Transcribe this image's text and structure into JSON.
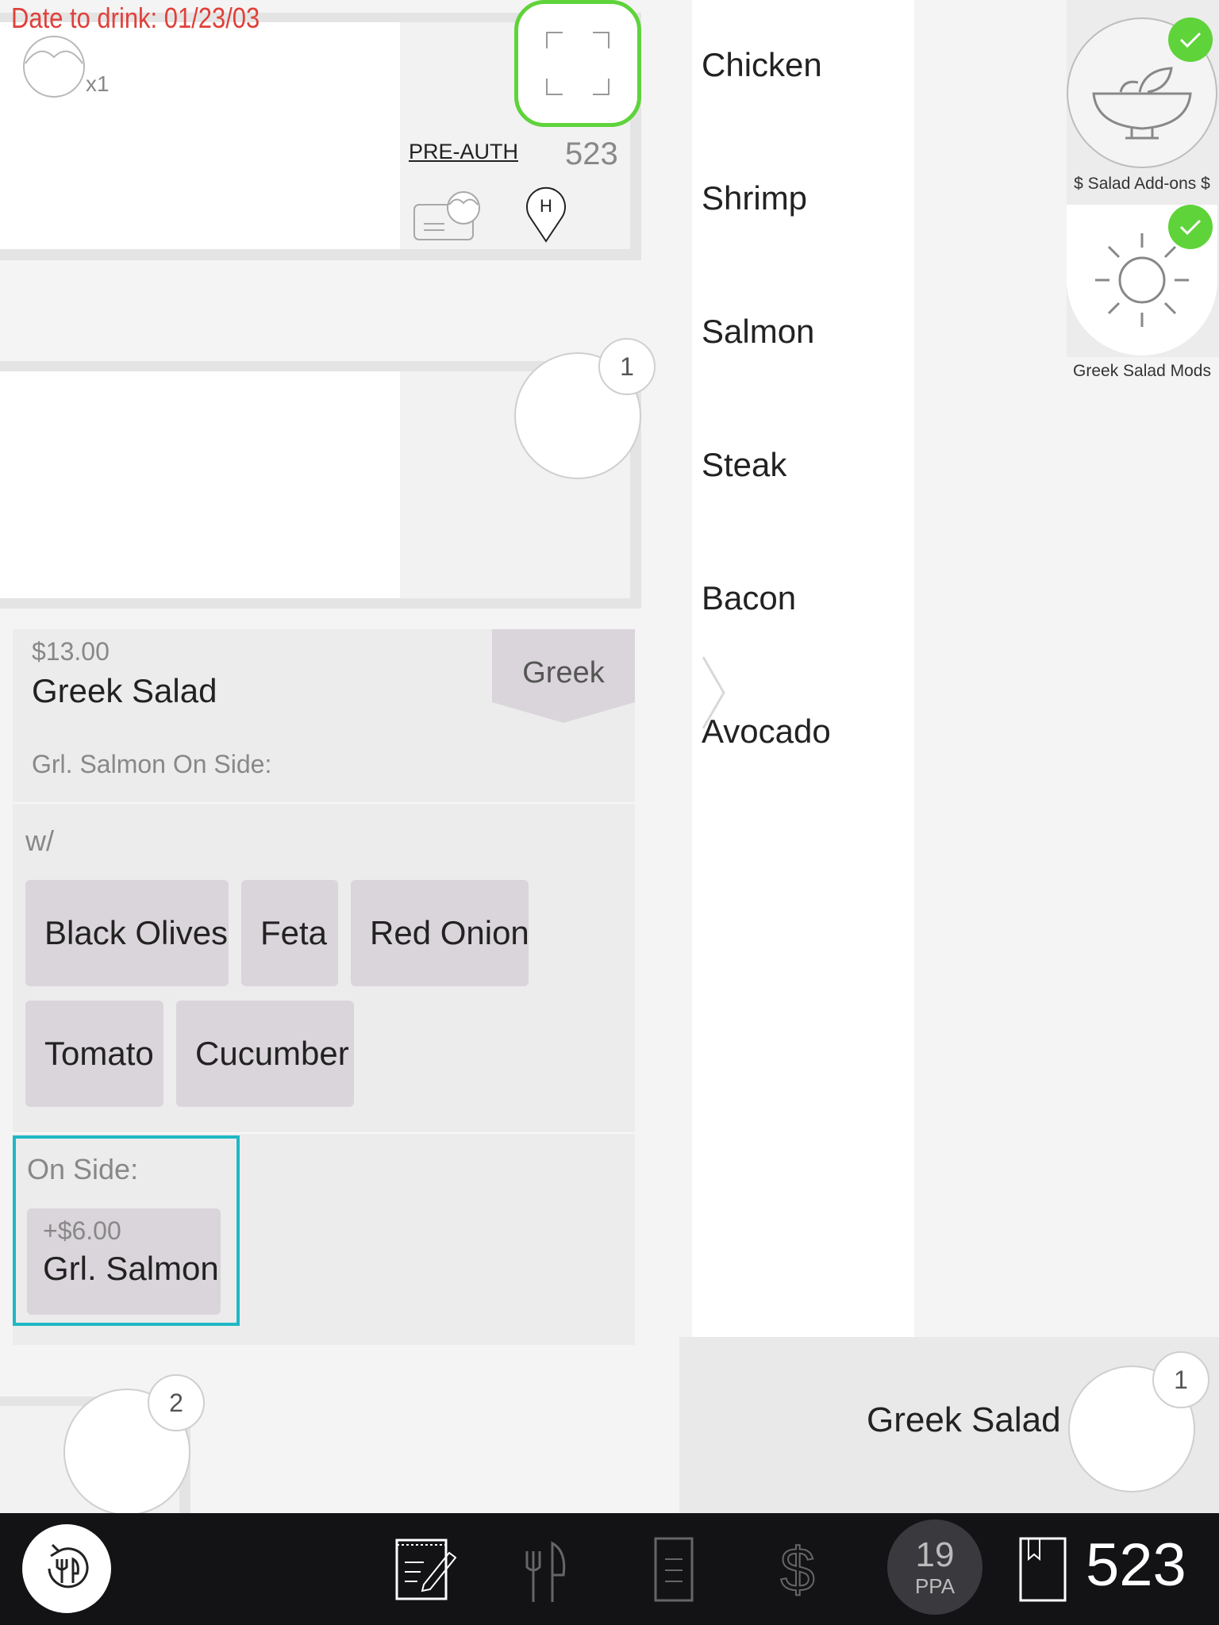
{
  "check": {
    "date_to_drink": "Date to drink: 01/23/03",
    "guest_count": "x1",
    "pre_auth": "PRE-AUTH",
    "check_number": "523",
    "hold_icon_letter": "H"
  },
  "seats": {
    "seat1_badge": "1",
    "seat2_badge": "2"
  },
  "order_item": {
    "price": "$13.00",
    "name": "Greek Salad",
    "tag": "Greek",
    "note": "Grl. Salmon On Side:",
    "with_label": "w/",
    "with_modifiers": [
      "Black Olives",
      "Feta",
      "Red Onion",
      "Tomato",
      "Cucumber"
    ],
    "on_side_label": "On Side:",
    "on_side_price": "+$6.00",
    "on_side_item": "Grl. Salmon"
  },
  "modifier_list": [
    "Chicken",
    "Shrimp",
    "Salmon",
    "Steak",
    "Bacon",
    "Avocado"
  ],
  "categories": [
    {
      "label": "$ Salad Add-ons $",
      "icon": "salad-bowl-icon",
      "checked": true
    },
    {
      "label": "Greek Salad Mods",
      "icon": "sun-icon",
      "checked": true
    }
  ],
  "summary": {
    "item_name": "Greek Salad",
    "seat_badge": "1"
  },
  "footer": {
    "ppa_value": "19",
    "ppa_label": "PPA",
    "check_number": "523"
  },
  "colors": {
    "alert_red": "#e0403a",
    "accent_green": "#5fd33a",
    "selection_teal": "#1fb8c4",
    "footer_bg": "#131316"
  }
}
